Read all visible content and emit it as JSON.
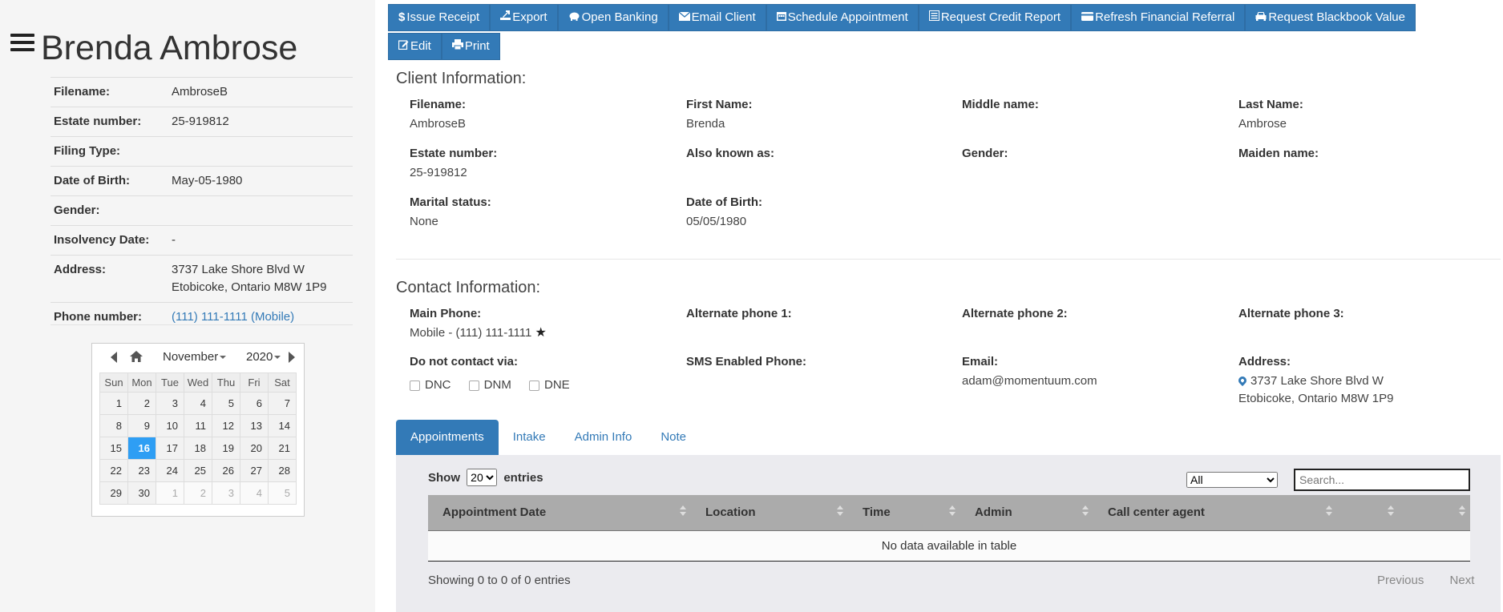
{
  "client_name": "Brenda Ambrose",
  "summary": [
    {
      "label": "Filename:",
      "value": "AmbroseB"
    },
    {
      "label": "Estate number:",
      "value": "25-919812"
    },
    {
      "label": "Filing Type:",
      "value": ""
    },
    {
      "label": "Date of Birth:",
      "value": "May-05-1980"
    },
    {
      "label": "Gender:",
      "value": ""
    },
    {
      "label": "Insolvency Date:",
      "value": "-"
    },
    {
      "label": "Address:",
      "value": "3737 Lake Shore Blvd W",
      "value2": "Etobicoke, Ontario M8W 1P9"
    },
    {
      "label": "Phone number:",
      "value": "(111) 111-1111 (Mobile)"
    }
  ],
  "calendar": {
    "month": "November",
    "year": "2020",
    "weekdays": [
      "Sun",
      "Mon",
      "Tue",
      "Wed",
      "Thu",
      "Fri",
      "Sat"
    ],
    "weeks": [
      [
        "1",
        "2",
        "3",
        "4",
        "5",
        "6",
        "7"
      ],
      [
        "8",
        "9",
        "10",
        "11",
        "12",
        "13",
        "14"
      ],
      [
        "15",
        "16",
        "17",
        "18",
        "19",
        "20",
        "21"
      ],
      [
        "22",
        "23",
        "24",
        "25",
        "26",
        "27",
        "28"
      ],
      [
        "29",
        "30",
        "1",
        "2",
        "3",
        "4",
        "5"
      ]
    ]
  },
  "toolbar": {
    "issue_receipt": "Issue Receipt",
    "export": "Export",
    "open_banking": "Open Banking",
    "email_client": "Email Client",
    "schedule_appointment": "Schedule Appointment",
    "request_credit_report": "Request Credit Report",
    "refresh_financial_referral": "Refresh Financial Referral",
    "request_blackbook_value": "Request Blackbook Value",
    "edit": "Edit",
    "print": "Print",
    "dollar_glyph": "$"
  },
  "client_info": {
    "title": "Client Information:",
    "filename_label": "Filename:",
    "filename": "AmbroseB",
    "first_name_label": "First Name:",
    "first_name": "Brenda",
    "middle_name_label": "Middle name:",
    "middle_name": "",
    "last_name_label": "Last Name:",
    "last_name": "Ambrose",
    "estate_label": "Estate number:",
    "estate": "25-919812",
    "aka_label": "Also known as:",
    "aka": "",
    "gender_label": "Gender:",
    "gender": "",
    "maiden_label": "Maiden name:",
    "maiden": "",
    "marital_label": "Marital status:",
    "marital": "None",
    "dob_label": "Date of Birth:",
    "dob": "05/05/1980"
  },
  "contact_info": {
    "title": "Contact Information:",
    "main_phone_label": "Main Phone:",
    "main_phone": "Mobile - (111) 111-1111",
    "alt1_label": "Alternate phone 1:",
    "alt2_label": "Alternate phone 2:",
    "alt3_label": "Alternate phone 3:",
    "dnc_label": "Do not contact via:",
    "dnc_options": [
      "DNC",
      "DNM",
      "DNE"
    ],
    "sms_label": "SMS Enabled Phone:",
    "email_label": "Email:",
    "email": "adam@momentuum.com",
    "address_label": "Address:",
    "address1": "3737 Lake Shore Blvd W",
    "address2": "Etobicoke, Ontario M8W 1P9",
    "star_glyph": "★"
  },
  "tabs": [
    "Appointments",
    "Intake",
    "Admin Info",
    "Note"
  ],
  "table": {
    "show_label": "Show",
    "entries_label": "entries",
    "page_size": "20",
    "filter_value": "All",
    "search_placeholder": "Search...",
    "columns": [
      "Appointment Date",
      "Location",
      "Time",
      "Admin",
      "Call center agent",
      "",
      ""
    ],
    "empty_message": "No data available in table",
    "info": "Showing 0 to 0 of 0 entries",
    "previous": "Previous",
    "next": "Next"
  },
  "colors": {
    "primary": "#337ab7",
    "today": "#2e9ef4",
    "header_gray": "#ababab"
  }
}
